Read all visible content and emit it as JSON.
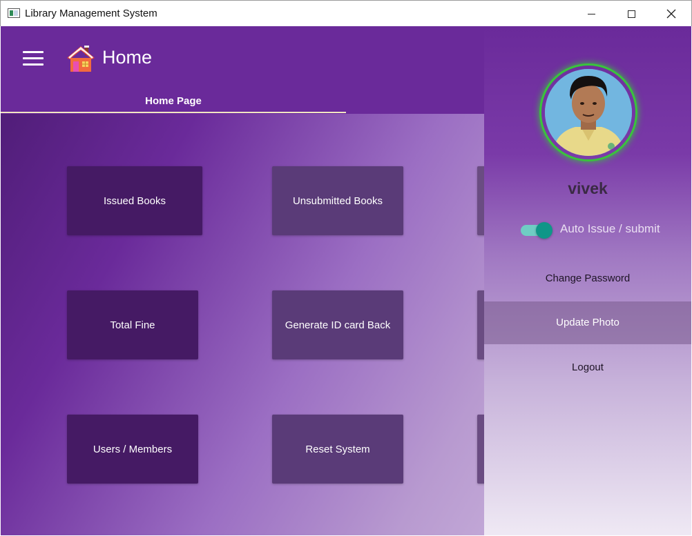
{
  "window": {
    "title": "Library Management System"
  },
  "header": {
    "title": "Home",
    "menu_icon": "hamburger-icon",
    "home_icon": "house-icon"
  },
  "tabs": [
    {
      "label": "Home Page",
      "active": true
    }
  ],
  "tiles": [
    {
      "label": "Issued Books"
    },
    {
      "label": "Unsubmitted Books"
    },
    {
      "label": "Total Fine"
    },
    {
      "label": "Generate ID card Back"
    },
    {
      "label": "Users / Members"
    },
    {
      "label": "Reset System"
    }
  ],
  "drawer": {
    "username": "vivek",
    "auto_toggle": {
      "label": "Auto Issue / submit",
      "on": true
    },
    "menu": {
      "change_password": "Change Password",
      "update_photo": "Update Photo",
      "logout": "Logout"
    }
  },
  "colors": {
    "header": "#6a2a9a",
    "tab_indicator": "#f3e6c2",
    "avatar_ring": "#39c43c",
    "toggle_on": "#0f9688"
  }
}
